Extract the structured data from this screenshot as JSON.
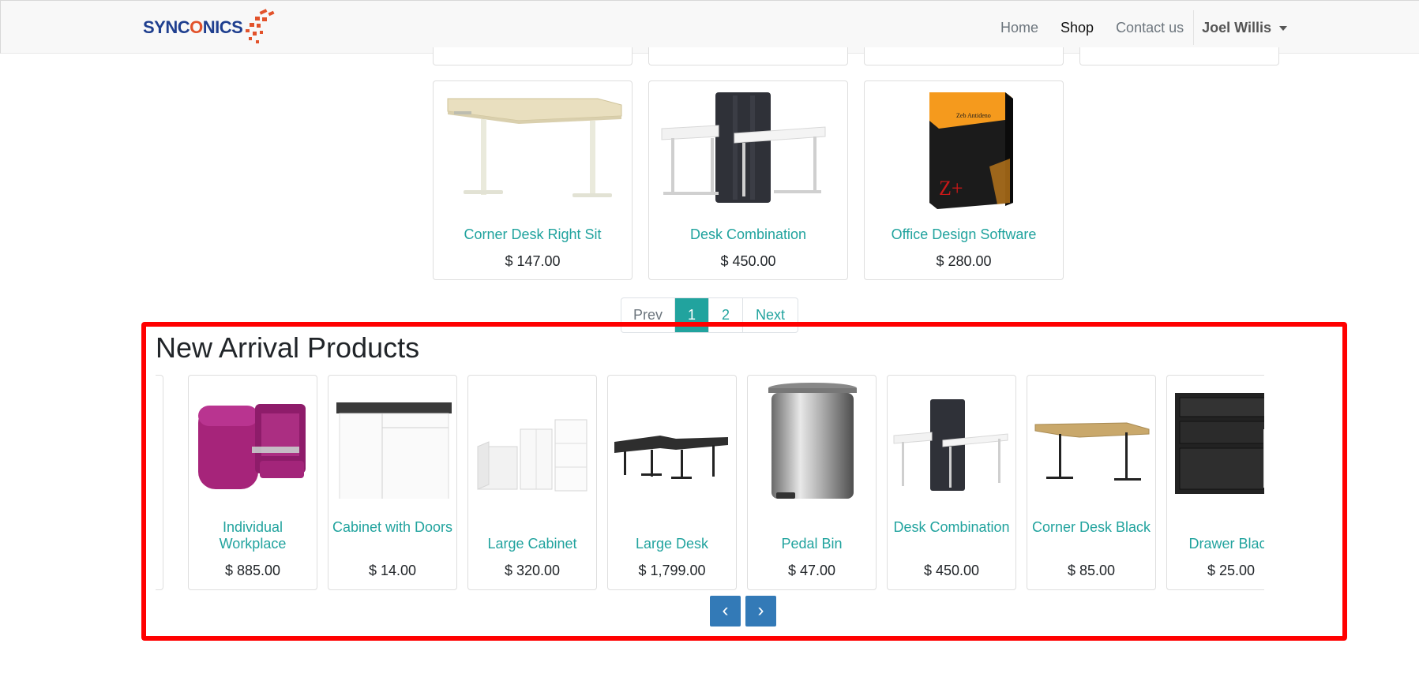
{
  "brand": {
    "logo_text_a": "SYNC",
    "logo_text_o": "O",
    "logo_text_b": "NICS"
  },
  "nav": {
    "links": [
      "Home",
      "Shop",
      "Contact us"
    ],
    "user": "Joel Willis"
  },
  "products": [
    {
      "name": "Corner Desk Right Sit",
      "price": "$ 147.00"
    },
    {
      "name": "Desk Combination",
      "price": "$ 450.00"
    },
    {
      "name": "Office Design Software",
      "price": "$ 280.00"
    }
  ],
  "pagination": {
    "prev": "Prev",
    "current": "1",
    "page2": "2",
    "next": "Next"
  },
  "new_arrivals": {
    "title": "New Arrival Products",
    "items": [
      {
        "name": "Individual Workplace",
        "price": "$ 885.00"
      },
      {
        "name": "Cabinet with Doors",
        "price": "$ 14.00"
      },
      {
        "name": "Large Cabinet",
        "price": "$ 320.00"
      },
      {
        "name": "Large Desk",
        "price": "$ 1,799.00"
      },
      {
        "name": "Pedal Bin",
        "price": "$ 47.00"
      },
      {
        "name": "Desk Combination",
        "price": "$ 450.00"
      },
      {
        "name": "Corner Desk Black",
        "price": "$ 85.00"
      },
      {
        "name": "Drawer Black",
        "price": "$ 25.00"
      }
    ],
    "prev_icon": "‹",
    "next_icon": "›"
  },
  "colors": {
    "accent": "#21a39e",
    "highlight": "#ff0000",
    "carousel_button": "#337ab7",
    "brand_blue": "#1f3f8f",
    "brand_orange": "#e2522b"
  }
}
